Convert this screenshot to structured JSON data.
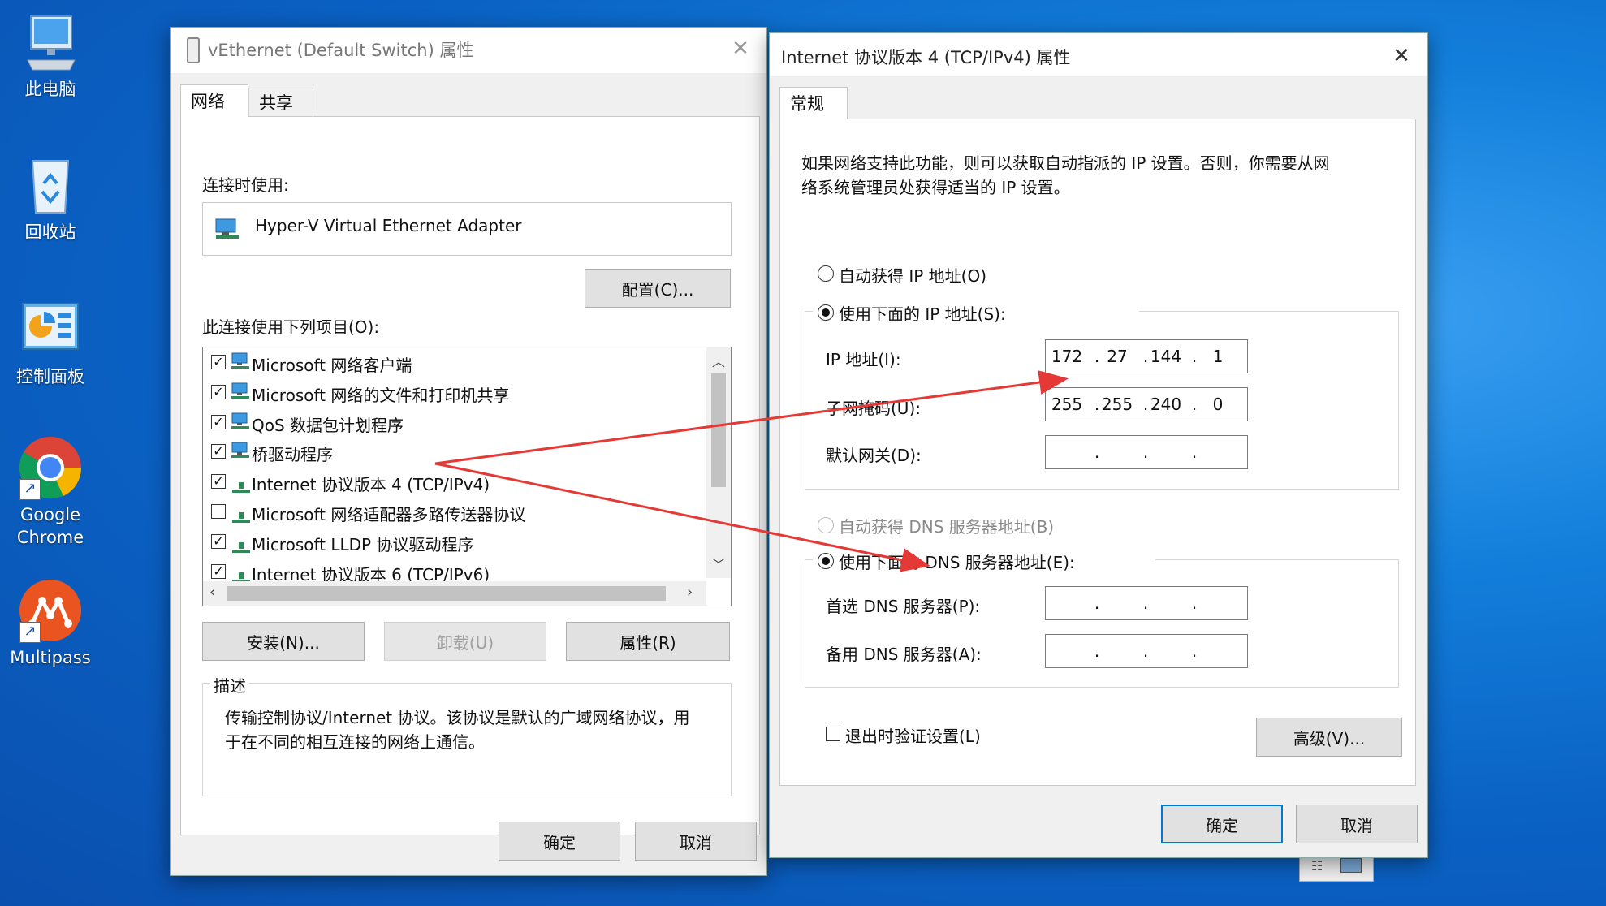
{
  "desktop": {
    "icons": [
      {
        "label": "此电脑",
        "icon": "this-pc-icon"
      },
      {
        "label": "回收站",
        "icon": "recycle-bin-icon"
      },
      {
        "label": "控制面板",
        "icon": "control-panel-icon"
      },
      {
        "label": "Google Chrome",
        "icon": "chrome-icon"
      },
      {
        "label": "Multipass",
        "icon": "multipass-icon"
      }
    ]
  },
  "adapter_window": {
    "title": "vEthernet (Default Switch) 属性",
    "tabs": [
      {
        "label": "网络",
        "active": true
      },
      {
        "label": "共享",
        "active": false
      }
    ],
    "connect_using_label": "连接时使用:",
    "adapter_name": "Hyper-V Virtual Ethernet Adapter",
    "configure_button": "配置(C)...",
    "items_label": "此连接使用下列项目(O):",
    "items": [
      {
        "label": "Microsoft 网络客户端",
        "checked": true
      },
      {
        "label": "Microsoft 网络的文件和打印机共享",
        "checked": true
      },
      {
        "label": "QoS 数据包计划程序",
        "checked": true
      },
      {
        "label": "桥驱动程序",
        "checked": true
      },
      {
        "label": "Internet 协议版本 4 (TCP/IPv4)",
        "checked": true
      },
      {
        "label": "Microsoft 网络适配器多路传送器协议",
        "checked": false
      },
      {
        "label": "Microsoft LLDP 协议驱动程序",
        "checked": true
      },
      {
        "label": "Internet 协议版本 6 (TCP/IPv6)",
        "checked": true
      }
    ],
    "install_button": "安装(N)...",
    "uninstall_button": "卸载(U)",
    "properties_button": "属性(R)",
    "description_legend": "描述",
    "description_text_line1": "传输控制协议/Internet 协议。该协议是默认的广域网络协议，用",
    "description_text_line2": "于在不同的相互连接的网络上通信。",
    "ok_button": "确定",
    "cancel_button": "取消"
  },
  "ipv4_window": {
    "title": "Internet 协议版本 4 (TCP/IPv4) 属性",
    "tab": "常规",
    "intro_line1": "如果网络支持此功能，则可以获取自动指派的 IP 设置。否则，你需要从网",
    "intro_line2": "络系统管理员处获得适当的 IP 设置。",
    "auto_ip_label": "自动获得 IP 地址(O)",
    "manual_ip_label": "使用下面的 IP 地址(S):",
    "ip_label": "IP 地址(I):",
    "ip_value": [
      "172",
      "27",
      "144",
      "1"
    ],
    "subnet_label": "子网掩码(U):",
    "subnet_value": [
      "255",
      "255",
      "240",
      "0"
    ],
    "gateway_label": "默认网关(D):",
    "auto_dns_label": "自动获得 DNS 服务器地址(B)",
    "manual_dns_label": "使用下面的 DNS 服务器地址(E):",
    "preferred_dns_label": "首选 DNS 服务器(P):",
    "alternate_dns_label": "备用 DNS 服务器(A):",
    "validate_label": "退出时验证设置(L)",
    "advanced_button": "高级(V)...",
    "ok_button": "确定",
    "cancel_button": "取消"
  },
  "colors": {
    "arrow": "#e53935",
    "accent": "#0078d7"
  }
}
